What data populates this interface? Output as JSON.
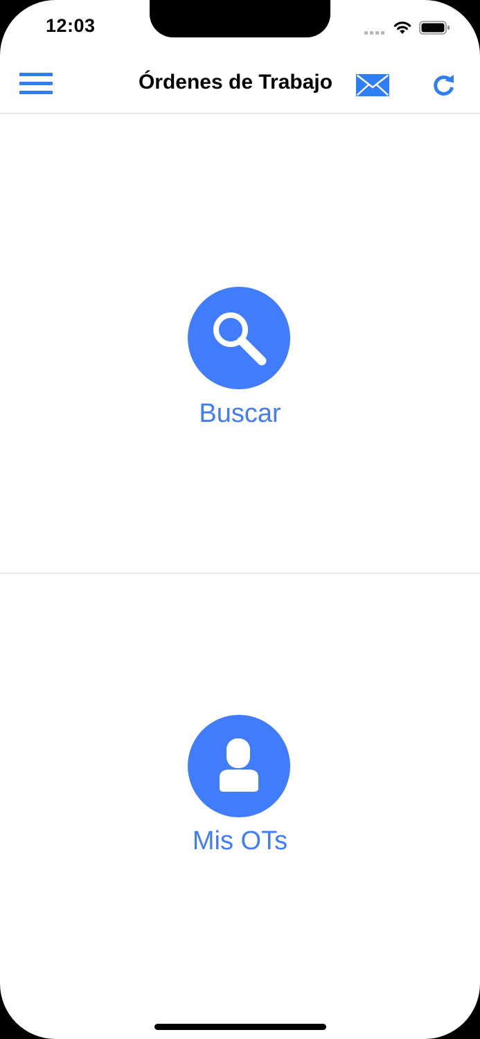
{
  "status_bar": {
    "time": "12:03"
  },
  "navbar": {
    "title": "Órdenes de Trabajo",
    "menu_icon": "hamburger-menu-icon",
    "mail_icon": "envelope-icon",
    "refresh_icon": "refresh-icon"
  },
  "actions": {
    "search": {
      "label": "Buscar",
      "icon": "magnifying-glass-icon"
    },
    "my_orders": {
      "label": "Mis OTs",
      "icon": "user-icon"
    }
  },
  "colors": {
    "accent": "#2f7ef4",
    "circle": "#407cfb",
    "divider": "#d4d4d4"
  }
}
